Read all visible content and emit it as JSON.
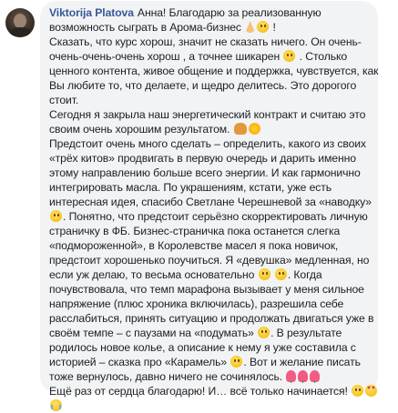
{
  "comment": {
    "author": "Viktorija Platova",
    "lines": [
      "Анна! Благодарю за реализованную",
      "возможность сыграть в Арома-бизнес",
      "Сказать, что курс хорош, значит не сказать ничего. Он очень-",
      "очень-очень-очень хорош , а точнее шикарен",
      ". Столько",
      "ценного контента, живое общение и поддержка, чувствуется, как",
      "Вы любите то, что делаете, и щедро делитесь. Это дорогого",
      "стоит.",
      "Сегодня я закрыла наш энергетический контракт и считаю это",
      "своим очень хорошим результатом.",
      "Предстоит очень много сделать – определить, какого из своих",
      "«трёх китов» продвигать в первую очередь и дарить именно",
      "этому направлению больше всего энергии. И как гармонично",
      "интегрировать масла. По украшениям, кстати, уже есть",
      "интересная идея, спасибо Светлане Черешневой за «наводку»",
      ". Понятно, что предстоит серьёзно скорректировать личную",
      "страничку в ФБ. Бизнес-страничка пока останется слегка",
      "«подмороженной», в Королевстве масел я пока новичок,",
      "предстоит хорошенько поучиться. Я «девушка» медленная, но",
      "если уж делаю, то весьма основательно",
      ". Когда",
      "почувствовала, что темп марафона вызывает у меня сильное",
      "напряжение (плюс хроника включилась), разрешила себе",
      "расслабиться, принять ситуацию и продолжать двигаться уже в",
      "своём темпе – с паузами на «подумать»",
      ". В результате",
      "родилось новое колье, а описание к нему я уже составила с",
      "историей – сказка про «Карамель»",
      ". Вот и желание писать",
      "тоже вернулось, давно ничего не сочинялось.",
      "Ещё раз от сердца благодарю! И… всё только начинается!",
      "!"
    ],
    "icons": {
      "avatar": "avatar",
      "pray": "folded-hands-emoji",
      "smile": "smiling-face-emoji",
      "bread": "bread-emoji",
      "sun": "sun-emoji",
      "thinking": "thinking-face-emoji",
      "tulip": "tulip-emoji",
      "heart_eyes": "smiling-face-with-hearts-emoji",
      "tears": "face-with-tears-emoji"
    },
    "colors": {
      "bubble": "#f2f3f5",
      "author": "#385898",
      "text": "#1c1e21"
    }
  }
}
